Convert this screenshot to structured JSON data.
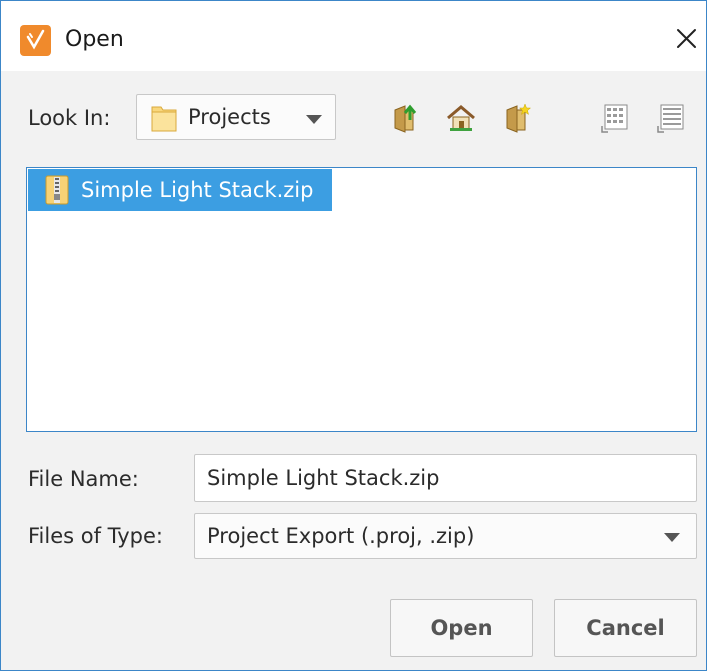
{
  "window": {
    "title": "Open",
    "app_icon": "app-logo-icon",
    "close_icon": "close-icon"
  },
  "toolbar": {
    "look_in_label": "Look In:",
    "look_in_value": "Projects",
    "icons": [
      "up-one-level-icon",
      "home-icon",
      "new-folder-icon",
      "list-view-icon",
      "details-view-icon"
    ]
  },
  "file_list": {
    "items": [
      {
        "name": "Simple Light Stack.zip",
        "icon": "zip-file-icon",
        "selected": true
      }
    ]
  },
  "form": {
    "file_name_label": "File Name:",
    "file_name_value": "Simple Light Stack.zip",
    "file_type_label": "Files of Type:",
    "file_type_value": "Project Export (.proj, .zip)"
  },
  "buttons": {
    "open_label": "Open",
    "cancel_label": "Cancel"
  },
  "colors": {
    "accent": "#3c86c8",
    "selection": "#3c9ee2",
    "app_icon": "#f08a2c"
  }
}
